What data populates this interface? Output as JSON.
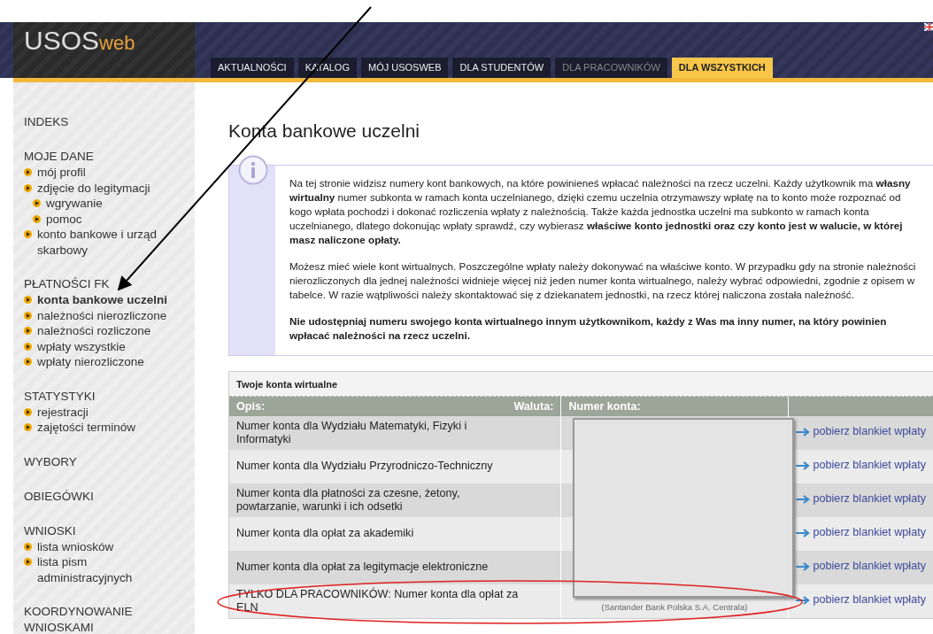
{
  "logo": {
    "text": "USOS",
    "suffix": "web"
  },
  "tabs": [
    {
      "label": "AKTUALNOŚCI",
      "selected": false,
      "disabled": false
    },
    {
      "label": "KATALOG",
      "selected": false,
      "disabled": false
    },
    {
      "label": "MÓJ USOSWEB",
      "selected": false,
      "disabled": false
    },
    {
      "label": "DLA STUDENTÓW",
      "selected": false,
      "disabled": false
    },
    {
      "label": "DLA PRACOWNIKÓW",
      "selected": false,
      "disabled": true
    },
    {
      "label": "DLA WSZYSTKICH",
      "selected": true,
      "disabled": false
    }
  ],
  "sidebar": {
    "sections": [
      {
        "heading": "INDEKS"
      },
      {
        "heading": "MOJE DANE",
        "items": [
          {
            "label": "mój profil",
            "selected": false
          },
          {
            "label": "zdjęcie do legitymacji",
            "selected": false,
            "children": [
              {
                "label": "wgrywanie",
                "selected": false
              },
              {
                "label": "pomoc",
                "selected": false
              }
            ]
          },
          {
            "label": "konto bankowe i urząd skarbowy",
            "selected": false
          }
        ]
      },
      {
        "heading": "PŁATNOŚCI FK",
        "items": [
          {
            "label": "konta bankowe uczelni",
            "selected": true
          },
          {
            "label": "należności nierozliczone",
            "selected": false
          },
          {
            "label": "należności rozliczone",
            "selected": false
          },
          {
            "label": "wpłaty wszystkie",
            "selected": false
          },
          {
            "label": "wpłaty nierozliczone",
            "selected": false
          }
        ]
      },
      {
        "heading": "STATYSTYKI",
        "items": [
          {
            "label": "rejestracji",
            "selected": false
          },
          {
            "label": "zajętości terminów",
            "selected": false
          }
        ]
      },
      {
        "heading": "WYBORY"
      },
      {
        "heading": "OBIEGÓWKI"
      },
      {
        "heading": "WNIOSKI",
        "items": [
          {
            "label": "lista wniosków",
            "selected": false
          },
          {
            "label": "lista pism administracyjnych",
            "selected": false
          }
        ]
      },
      {
        "heading": "KOORDYNOWANIE WNIOSKAMI"
      }
    ]
  },
  "page_title": "Konta bankowe uczelni",
  "info": {
    "paragraphs": [
      "Na tej stronie widzisz numery kont bankowych, na które powinieneś wpłacać należności na rzecz uczelni. Każdy użytkownik ma **własny wirtualny** numer subkonta w ramach konta uczelnianego, dzięki czemu uczelnia otrzymawszy wpłatę na to konto może rozpoznać od kogo wpłata pochodzi i dokonać rozliczenia wpłaty z należnością. Także każda jednostka uczelni ma subkonto w ramach konta uczelnianego, dlatego dokonując wpłaty sprawdź, czy wybierasz **właściwe konto jednostki oraz czy konto jest w walucie, w której masz naliczone opłaty.**",
      "Możesz mieć wiele kont wirtualnych. Poszczególne wpłaty należy dokonywać na właściwe konto. W przypadku gdy na stronie należności nierozliczonych dla jednej należności widnieje więcej niż jeden numer konta wirtualnego, należy wybrać odpowiedni, zgodnie z opisem w tabelce. W razie wątpliwości należy skontaktować się z dziekanatem jednostki, na rzecz której naliczona została należność.",
      "**Nie udostępniaj numeru swojego konta wirtualnego innym użytkownikom, każdy z Was ma inny numer, na który powinien wpłacać należności na rzecz uczelni.**"
    ]
  },
  "table": {
    "caption": "Twoje konta wirtualne",
    "columns": [
      "Opis:",
      "Waluta:",
      "Numer konta:"
    ],
    "rows": [
      {
        "description": "Numer konta dla Wydziału Matematyki, Fizyki i Informatyki",
        "link": "pobierz blankiet wpłaty"
      },
      {
        "description": "Numer konta dla Wydziału Przyrodniczo-Techniczny",
        "link": "pobierz blankiet wpłaty"
      },
      {
        "description": "Numer konta dla płatności za czesne, żetony, powtarzanie, warunki i ich odsetki",
        "link": "pobierz blankiet wpłaty"
      },
      {
        "description": "Numer konta dla opłat za akademiki",
        "link": "pobierz blankiet wpłaty"
      },
      {
        "description": "Numer konta dla opłat za legitymacje elektroniczne",
        "link": "pobierz blankiet wpłaty"
      },
      {
        "description": "TYLKO DLA PRACOWNIKÓW: Numer konta dla opłat za ELN",
        "link": "pobierz blankiet wpłaty",
        "note": "(Santander Bank Polska S.A. Centrala)"
      }
    ]
  }
}
